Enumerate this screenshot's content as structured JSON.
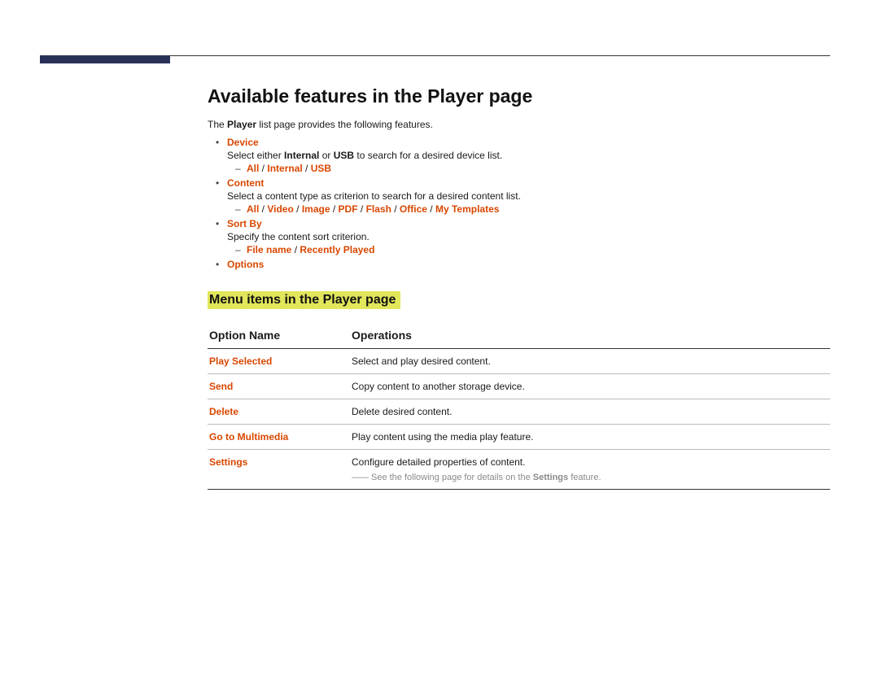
{
  "heading": "Available features in the Player page",
  "intro": {
    "pre": "The ",
    "bold": "Player",
    "post": " list page provides the following features."
  },
  "features": [
    {
      "title": "Device",
      "desc_pre": "Select either ",
      "b1": "Internal",
      "mid": " or ",
      "b2": "USB",
      "desc_post": " to search for a desired device list.",
      "sub": [
        "All",
        "Internal",
        "USB"
      ]
    },
    {
      "title": "Content",
      "desc": "Select a content type as criterion to search for a desired content list.",
      "sub": [
        "All",
        "Video",
        "Image",
        "PDF",
        "Flash",
        "Office",
        "My Templates"
      ]
    },
    {
      "title": "Sort By",
      "desc": "Specify the content sort criterion.",
      "sub": [
        "File name",
        "Recently Played"
      ]
    },
    {
      "title": "Options"
    }
  ],
  "sub_heading": "Menu items in the Player page",
  "table": {
    "col1": "Option Name",
    "col2": "Operations",
    "rows": [
      {
        "name": "Play Selected",
        "op": "Select and play desired content."
      },
      {
        "name": "Send",
        "op": "Copy content to another storage device."
      },
      {
        "name": "Delete",
        "op": "Delete desired content."
      },
      {
        "name": "Go to Multimedia",
        "op": "Play content using the media play feature."
      },
      {
        "name": "Settings",
        "op": "Configure detailed properties of content.",
        "note_pre": "See the following page for details on the ",
        "note_bold": "Settings",
        "note_post": " feature."
      }
    ]
  },
  "sep": " / ",
  "dash": "――"
}
